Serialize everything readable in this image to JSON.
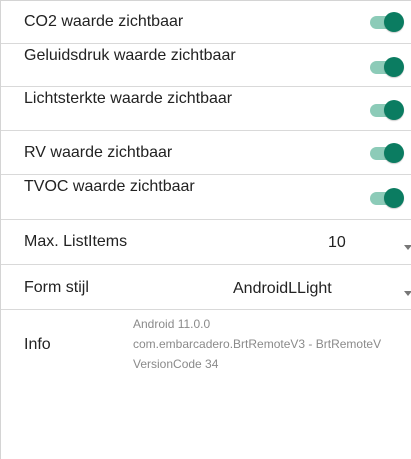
{
  "toggles": [
    {
      "label": "CO2 waarde zichtbaar",
      "enabled": true
    },
    {
      "label": "Geluidsdruk waarde zichtbaar",
      "enabled": true
    },
    {
      "label": "Lichtsterkte waarde zichtbaar",
      "enabled": true
    },
    {
      "label": "RV waarde zichtbaar",
      "enabled": true
    },
    {
      "label": "TVOC waarde zichtbaar",
      "enabled": true
    }
  ],
  "max_list_items": {
    "label": "Max. ListItems",
    "value": "10"
  },
  "form_style": {
    "label": "Form stijl",
    "value": "AndroidLLight"
  },
  "info": {
    "label": "Info",
    "lines": [
      "Android 11.0.0",
      "com.embarcadero.BrtRemoteV3 - BrtRemoteV",
      "VersionCode 34"
    ]
  },
  "colors": {
    "switch_thumb": "#0b7c61",
    "switch_track": "#8ccbb8",
    "divider": "#d9d9d9",
    "secondary_text": "#8a8a8a"
  }
}
